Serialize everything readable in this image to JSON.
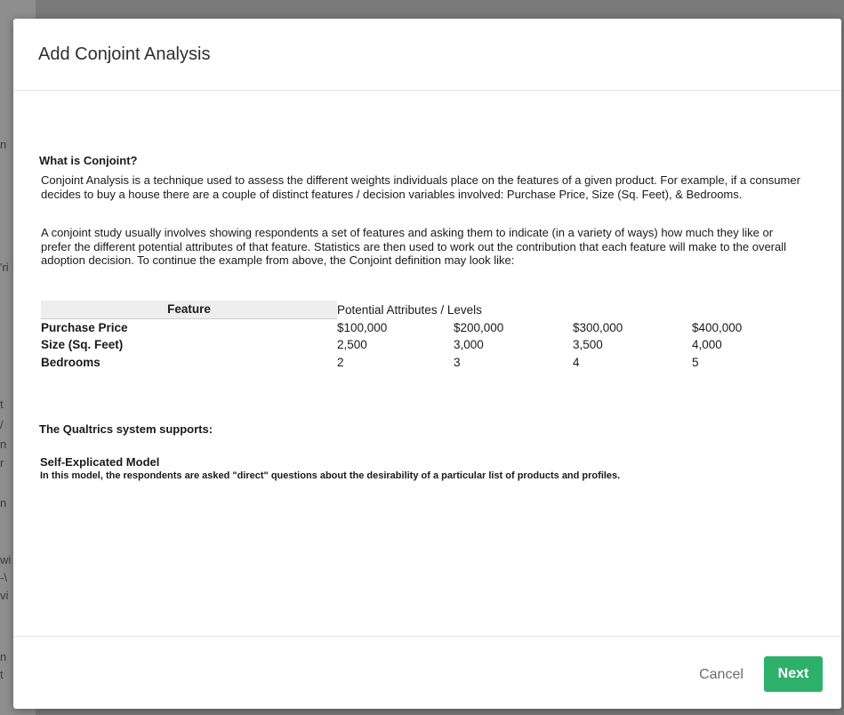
{
  "background": {
    "fragments": [
      "n",
      "'ri",
      "t",
      "/",
      "n",
      "r",
      "n",
      "wi",
      "-\\",
      "vi",
      "n",
      "t"
    ]
  },
  "modal": {
    "title": "Add Conjoint Analysis",
    "what_is_heading": "What is Conjoint?",
    "paragraph1": "Conjoint Analysis is a technique used to assess the different weights individuals place on the features of a given product. For example, if a consumer decides to buy a house there are a couple of distinct features / decision variables involved: Purchase Price, Size (Sq. Feet), & Bedrooms.",
    "paragraph2": "A conjoint study usually involves showing respondents a set of features and asking them to indicate (in a variety of ways) how much they like or prefer the different potential attributes of that feature. Statistics are then used to work out the contribution that each feature will make to the overall adoption decision. To continue the example from above, the Conjoint definition may look like:",
    "table": {
      "feature_header": "Feature",
      "levels_header": "Potential Attributes / Levels",
      "rows": [
        {
          "feature": "Purchase Price",
          "levels": [
            "$100,000",
            "$200,000",
            "$300,000",
            "$400,000"
          ]
        },
        {
          "feature": "Size (Sq. Feet)",
          "levels": [
            "2,500",
            "3,000",
            "3,500",
            "4,000"
          ]
        },
        {
          "feature": "Bedrooms",
          "levels": [
            "2",
            "3",
            "4",
            "5"
          ]
        }
      ]
    },
    "supports_heading": "The Qualtrics system supports:",
    "model_title": "Self-Explicated Model",
    "model_description": "In this model, the respondents are asked \"direct\" questions about the desirability of a particular list of products and profiles."
  },
  "footer": {
    "cancel_label": "Cancel",
    "next_label": "Next"
  },
  "colors": {
    "primary_button": "#2db06a",
    "overlay": "#7a7a7a"
  }
}
